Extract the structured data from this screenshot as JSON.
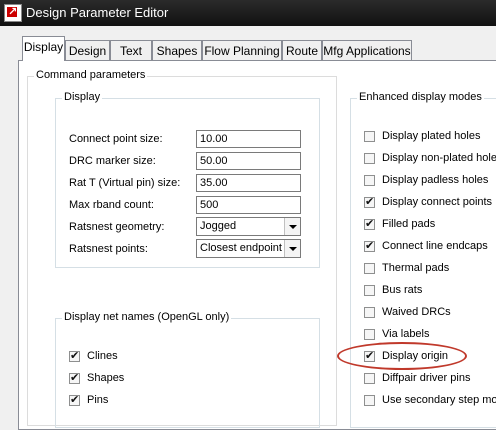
{
  "window": {
    "title": "Design Parameter Editor"
  },
  "tabs": [
    {
      "label": "Display",
      "active": true
    },
    {
      "label": "Design"
    },
    {
      "label": "Text"
    },
    {
      "label": "Shapes"
    },
    {
      "label": "Flow Planning"
    },
    {
      "label": "Route"
    },
    {
      "label": "Mfg Applications"
    }
  ],
  "command_parameters": {
    "title": "Command parameters",
    "display": {
      "title": "Display",
      "fields": [
        {
          "label": "Connect point size:",
          "value": "10.00"
        },
        {
          "label": "DRC marker size:",
          "value": "50.00"
        },
        {
          "label": "Rat T (Virtual pin) size:",
          "value": "35.00"
        },
        {
          "label": "Max rband count:",
          "value": "500"
        }
      ],
      "selects": [
        {
          "label": "Ratsnest geometry:",
          "value": "Jogged"
        },
        {
          "label": "Ratsnest points:",
          "value": "Closest endpoint"
        }
      ]
    },
    "net_names": {
      "title": "Display net names (OpenGL only)",
      "items": [
        {
          "label": "Clines",
          "checked": true
        },
        {
          "label": "Shapes",
          "checked": true
        },
        {
          "label": "Pins",
          "checked": true
        }
      ]
    }
  },
  "enhanced_display": {
    "title": "Enhanced display modes",
    "items": [
      {
        "label": "Display plated holes",
        "checked": false
      },
      {
        "label": "Display non-plated holes",
        "checked": false
      },
      {
        "label": "Display padless holes",
        "checked": false
      },
      {
        "label": "Display connect points",
        "checked": true
      },
      {
        "label": "Filled pads",
        "checked": true
      },
      {
        "label": "Connect line endcaps",
        "checked": true
      },
      {
        "label": "Thermal pads",
        "checked": false
      },
      {
        "label": "Bus rats",
        "checked": false
      },
      {
        "label": "Waived DRCs",
        "checked": false
      },
      {
        "label": "Via labels",
        "checked": false
      },
      {
        "label": "Display origin",
        "checked": true
      },
      {
        "label": "Diffpair driver pins",
        "checked": false
      },
      {
        "label": "Use secondary step models",
        "checked": false
      }
    ]
  },
  "colors": {
    "highlight": "#c0392b",
    "titlebar": "#1a1a1a"
  }
}
